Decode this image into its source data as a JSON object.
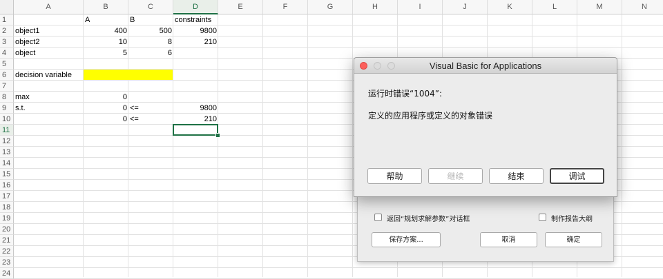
{
  "spreadsheet": {
    "columns": [
      "A",
      "B",
      "C",
      "D",
      "E",
      "F",
      "G",
      "H",
      "I",
      "J",
      "K",
      "L",
      "M",
      "N"
    ],
    "active_column": "D",
    "active_row": 11,
    "rows": [
      1,
      2,
      3,
      4,
      5,
      6,
      7,
      8,
      9,
      10,
      11,
      12,
      13,
      14,
      15,
      16,
      17,
      18,
      19,
      20,
      21,
      22,
      23,
      24
    ],
    "cells": {
      "B1": "A",
      "C1": "B",
      "D1": "constraints",
      "A2": "object1",
      "B2": "400",
      "C2": "500",
      "D2": "9800",
      "A3": "object2",
      "B3": "10",
      "C3": "8",
      "D3": "210",
      "A4": "object",
      "B4": "5",
      "C4": "6",
      "A6": "decision variable",
      "A8": "max",
      "B8": "0",
      "A9": "s.t.",
      "B9": "0",
      "C9": "<=",
      "D9": "9800",
      "B10": "0",
      "C10": "<=",
      "D10": "210"
    },
    "highlight_color": "#ffff00",
    "selection_color": "#1e7145"
  },
  "vba_dialog": {
    "title": "Visual Basic for Applications",
    "error_line": "运行时错误“1004”:",
    "message": "定义的应用程序或定义的对象错误",
    "buttons": [
      {
        "label": "帮助",
        "enabled": true
      },
      {
        "label": "继续",
        "enabled": false
      },
      {
        "label": "结束",
        "enabled": true
      },
      {
        "label": "调试",
        "enabled": true,
        "default": true
      }
    ]
  },
  "solver_dialog": {
    "return_checkbox_label": "返回“规划求解参数”对话框",
    "outline_checkbox_label": "制作报告大纲",
    "save_button": "保存方案...",
    "cancel_button": "取消",
    "ok_button": "确定"
  }
}
